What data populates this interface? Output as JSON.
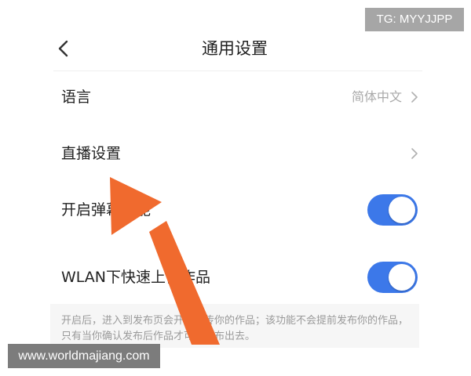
{
  "header": {
    "title": "通用设置",
    "back_icon": "chevron-left-icon"
  },
  "settings": [
    {
      "label": "语言",
      "value": "简体中文",
      "control": "chevron-right-icon"
    },
    {
      "label": "直播设置",
      "control": "chevron-right-icon"
    },
    {
      "label": "开启弹幕功能",
      "control": "toggle",
      "toggle_on": true
    },
    {
      "label": "WLAN下快速上传作品",
      "control": "toggle",
      "toggle_on": true
    }
  ],
  "hint": "开启后，进入到发布页会开始上传你的作品；该功能不会提前发布你的作品，只有当你确认发布后作品才可能发布出去。",
  "overlay": {
    "arrow_icon": "pointer-arrow-icon",
    "arrow_color": "#f06a2e"
  },
  "watermarks": {
    "tg": "TG: MYYJJPP",
    "site": "www.worldmajiang.com"
  },
  "colors": {
    "toggle_on": "#3c78e9",
    "secondary_text": "#a9a9a9",
    "hint_background": "#f6f6f6"
  }
}
